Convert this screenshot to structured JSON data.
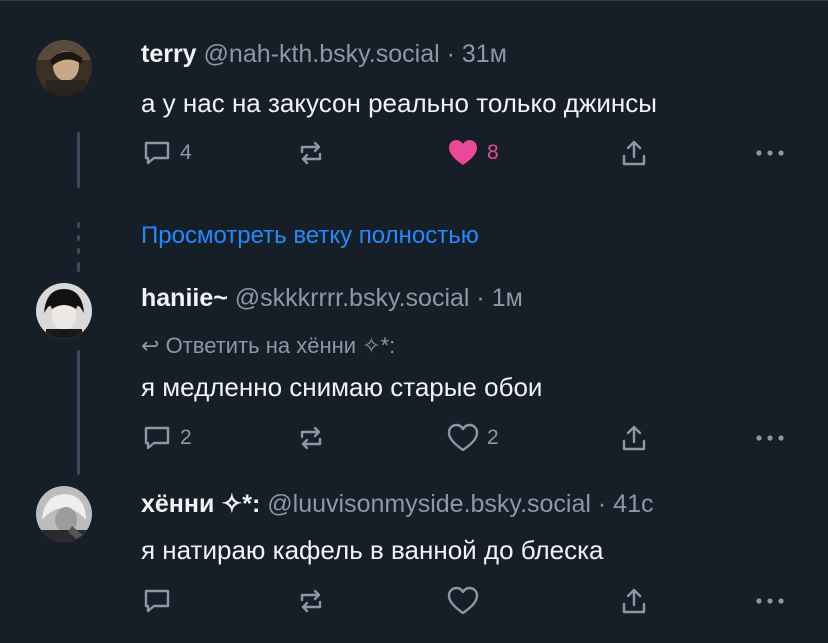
{
  "posts": [
    {
      "name": "terry",
      "handle": "@nah-kth.bsky.social",
      "sep": "·",
      "time": "31м",
      "text": "а у нас на закусон реально только джинсы",
      "reply_count": "4",
      "repost_count": "",
      "like_count": "8",
      "liked": true
    },
    {
      "name": "haniie~",
      "handle": "@skkkrrrr.bsky.social",
      "sep": "·",
      "time": "1м",
      "reply_to": "Ответить на хённи ✧*:",
      "text": "я медленно снимаю старые обои",
      "reply_count": "2",
      "like_count": "2",
      "liked": false
    },
    {
      "name": "хённи ✧*:",
      "handle": "@luuvisonmyside.bsky.social",
      "sep": "·",
      "time": "41с",
      "text": "я натираю кафель в ванной до блеска",
      "reply_count": "",
      "like_count": "",
      "liked": false
    }
  ],
  "view_thread_label": "Просмотреть ветку полностью",
  "colors": {
    "background": "#161e27",
    "link": "#208bfe",
    "like": "#ec4899",
    "muted": "#8b98a5"
  },
  "icons": [
    "reply-icon",
    "repost-icon",
    "like-icon",
    "share-icon",
    "more-icon"
  ]
}
